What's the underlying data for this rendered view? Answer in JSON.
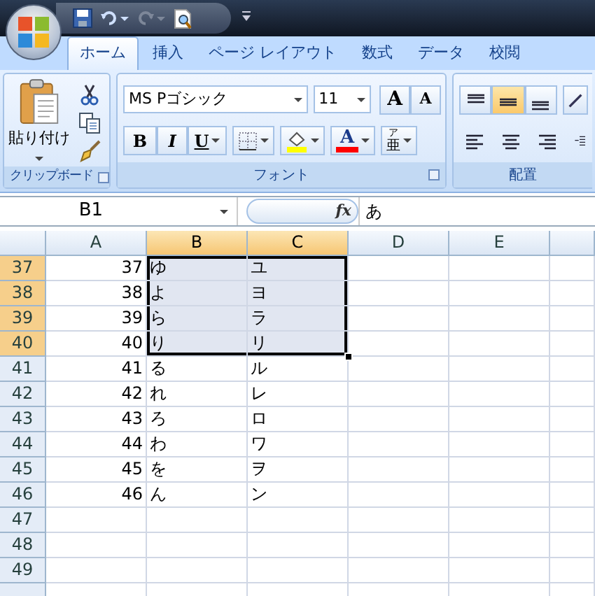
{
  "quick_access": {
    "undo_enabled": true,
    "redo_enabled": false
  },
  "ribbon": {
    "tabs": [
      {
        "label": "ホーム",
        "selected": true
      },
      {
        "label": "挿入",
        "selected": false
      },
      {
        "label": "ページ レイアウト",
        "selected": false
      },
      {
        "label": "数式",
        "selected": false
      },
      {
        "label": "データ",
        "selected": false
      },
      {
        "label": "校閲",
        "selected": false
      }
    ],
    "clipboard": {
      "paste_label": "貼り付け",
      "group_label": "クリップボード"
    },
    "font": {
      "font_name": "MS Pゴシック",
      "font_size": "11",
      "grow_label": "A",
      "shrink_label": "A",
      "bold_label": "B",
      "italic_label": "I",
      "underline_label": "U",
      "color_label": "A",
      "phonetic_ruby": "ア",
      "phonetic_base": "亜",
      "group_label": "フォント"
    },
    "alignment": {
      "vertical": [
        {
          "kind": "top",
          "selected": false
        },
        {
          "kind": "middle",
          "selected": true
        },
        {
          "kind": "bottom",
          "selected": false
        }
      ],
      "group_label": "配置"
    }
  },
  "formula_bar": {
    "name_box": "B1",
    "function_label": "fx",
    "value": "あ"
  },
  "sheet": {
    "columns": [
      {
        "label": "A",
        "selected": false
      },
      {
        "label": "B",
        "selected": true
      },
      {
        "label": "C",
        "selected": true
      },
      {
        "label": "D",
        "selected": false
      },
      {
        "label": "E",
        "selected": false
      }
    ],
    "rows": [
      {
        "label": "37",
        "selected": true,
        "cells": [
          "37",
          "ゆ",
          "ユ"
        ]
      },
      {
        "label": "38",
        "selected": true,
        "cells": [
          "38",
          "よ",
          "ヨ"
        ]
      },
      {
        "label": "39",
        "selected": true,
        "cells": [
          "39",
          "ら",
          "ラ"
        ]
      },
      {
        "label": "40",
        "selected": true,
        "cells": [
          "40",
          "り",
          "リ"
        ]
      },
      {
        "label": "41",
        "selected": false,
        "cells": [
          "41",
          "る",
          "ル"
        ]
      },
      {
        "label": "42",
        "selected": false,
        "cells": [
          "42",
          "れ",
          "レ"
        ]
      },
      {
        "label": "43",
        "selected": false,
        "cells": [
          "43",
          "ろ",
          "ロ"
        ]
      },
      {
        "label": "44",
        "selected": false,
        "cells": [
          "44",
          "わ",
          "ワ"
        ]
      },
      {
        "label": "45",
        "selected": false,
        "cells": [
          "45",
          "を",
          "ヲ"
        ]
      },
      {
        "label": "46",
        "selected": false,
        "cells": [
          "46",
          "ん",
          "ン"
        ]
      },
      {
        "label": "47",
        "selected": false,
        "cells": []
      },
      {
        "label": "48",
        "selected": false,
        "cells": []
      },
      {
        "label": "49",
        "selected": false,
        "cells": []
      }
    ]
  }
}
